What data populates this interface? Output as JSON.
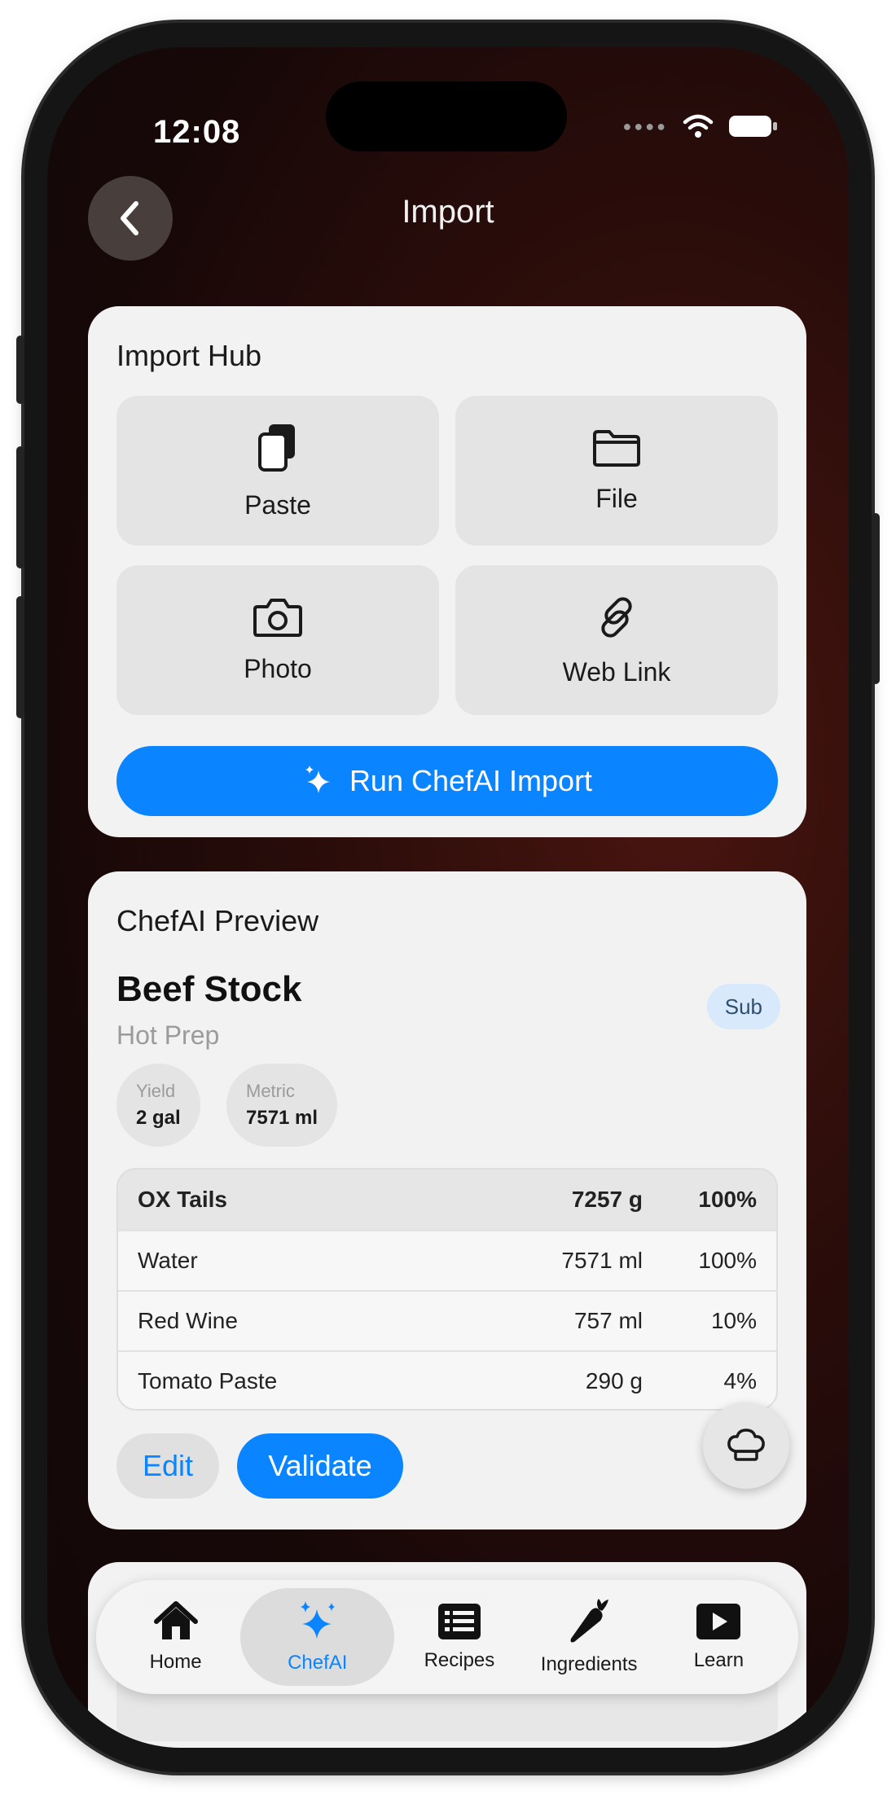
{
  "status_bar": {
    "time": "12:08"
  },
  "nav": {
    "title": "Import"
  },
  "import_hub": {
    "title": "Import Hub",
    "tiles": [
      {
        "label": "Paste",
        "icon": "clipboard-icon"
      },
      {
        "label": "File",
        "icon": "folder-icon"
      },
      {
        "label": "Photo",
        "icon": "camera-icon"
      },
      {
        "label": "Web Link",
        "icon": "link-icon"
      }
    ],
    "run_button": "Run ChefAI Import"
  },
  "preview": {
    "title": "ChefAI Preview",
    "recipe_name": "Beef Stock",
    "category": "Hot Prep",
    "badge": "Sub",
    "chips": [
      {
        "key": "Yield",
        "value": "2 gal"
      },
      {
        "key": "Metric",
        "value": "7571 ml"
      }
    ],
    "ingredients": [
      {
        "name": "OX Tails",
        "amount": "7257 g",
        "percent": "100%"
      },
      {
        "name": "Water",
        "amount": "7571 ml",
        "percent": "100%"
      },
      {
        "name": "Red Wine",
        "amount": "757 ml",
        "percent": "10%"
      },
      {
        "name": "Tomato Paste",
        "amount": "290 g",
        "percent": "4%"
      }
    ],
    "edit_button": "Edit",
    "validate_button": "Validate"
  },
  "tabs": [
    {
      "label": "Home",
      "icon": "house-icon",
      "active": false
    },
    {
      "label": "ChefAI",
      "icon": "sparkles-icon",
      "active": true
    },
    {
      "label": "Recipes",
      "icon": "list-icon",
      "active": false
    },
    {
      "label": "Ingredients",
      "icon": "carrot-icon",
      "active": false
    },
    {
      "label": "Learn",
      "icon": "play-icon",
      "active": false
    }
  ],
  "colors": {
    "accent": "#0a84ff",
    "card": "#f2f2f2",
    "badge_bg": "#d8e9fb"
  }
}
